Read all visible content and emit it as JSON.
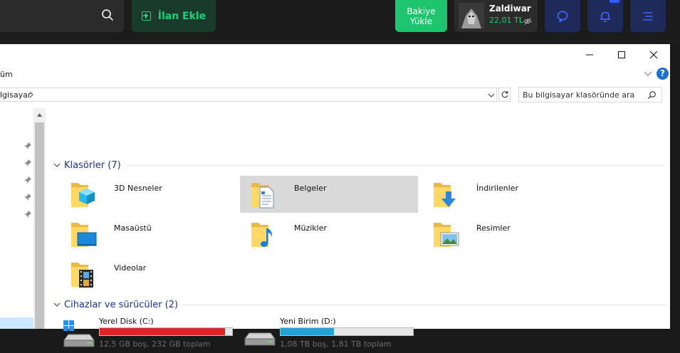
{
  "site_header": {
    "ilan_label": "İlan Ekle",
    "bakiye_line1": "Bakiye",
    "bakiye_line2": "Yükle",
    "user_name": "Zaldiwar",
    "user_balance": "22,01 TL",
    "bell_badge": "",
    "colors": {
      "green": "#1fd07a",
      "nav_blue": "#1f2a5a"
    }
  },
  "explorer": {
    "ribbon_tab": "üm",
    "address": "lgisayar",
    "search_placeholder": "Bu bilgisayar klasöründe ara",
    "help_label": "?",
    "groups": {
      "folders_header": "Klasörler (7)",
      "folders": [
        {
          "label": "3D Nesneler",
          "icon": "3d-objects-folder-icon"
        },
        {
          "label": "Belgeler",
          "icon": "documents-folder-icon",
          "selected": true
        },
        {
          "label": "İndirilenler",
          "icon": "downloads-folder-icon"
        },
        {
          "label": "Masaüstü",
          "icon": "desktop-folder-icon"
        },
        {
          "label": "Müzikler",
          "icon": "music-folder-icon"
        },
        {
          "label": "Resimler",
          "icon": "pictures-folder-icon"
        },
        {
          "label": "Videolar",
          "icon": "videos-folder-icon"
        }
      ],
      "drives_header": "Cihazlar ve sürücüler (2)",
      "drives": [
        {
          "name": "Yerel Disk (C:)",
          "info": "12,5 GB boş, 232 GB toplam",
          "used_fraction": 0.946,
          "bar_color": "#da2626"
        },
        {
          "name": "Yeni Birim (D:)",
          "info": "1,08 TB boş, 1,81 TB toplam",
          "used_fraction": 0.403,
          "bar_color": "#26a0da"
        }
      ]
    }
  }
}
